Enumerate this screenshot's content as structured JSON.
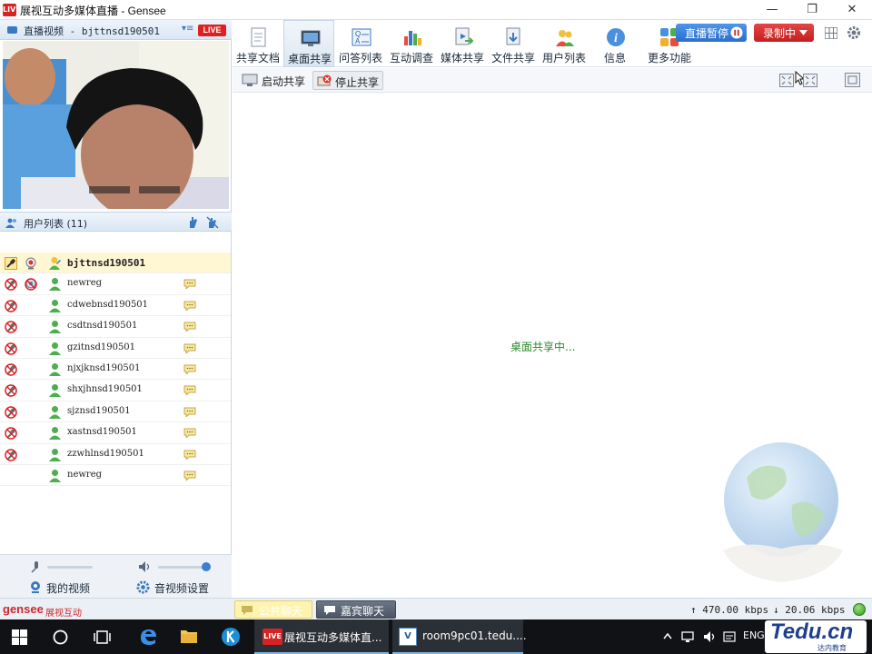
{
  "window": {
    "title": "展视互动多媒体直播 - Gensee",
    "logo_text": "LIVE",
    "min_label": "—",
    "restore_label": "❐",
    "close_label": "✕"
  },
  "video_panel": {
    "title": "直播视频 - bjttnsd190501",
    "dropdown_icon": "▾≡",
    "live_badge": "LIVE"
  },
  "user_list": {
    "title": "用户列表 (11)",
    "users": [
      {
        "name": "bjttnsd190501",
        "selected": true,
        "mic": "mic-active",
        "cam": "cam-active",
        "avatar": "presenter",
        "chat": false
      },
      {
        "name": "newreg",
        "selected": false,
        "mic": "mic-muted",
        "cam": "cam-off",
        "avatar": "user",
        "chat": true
      },
      {
        "name": "cdwebnsd190501",
        "selected": false,
        "mic": "mic-muted",
        "cam": "",
        "avatar": "user",
        "chat": true
      },
      {
        "name": "csdtnsd190501",
        "selected": false,
        "mic": "mic-muted",
        "cam": "",
        "avatar": "user",
        "chat": true
      },
      {
        "name": "gzitnsd190501",
        "selected": false,
        "mic": "mic-muted",
        "cam": "",
        "avatar": "user",
        "chat": true
      },
      {
        "name": "njxjknsd190501",
        "selected": false,
        "mic": "mic-muted",
        "cam": "",
        "avatar": "user",
        "chat": true
      },
      {
        "name": "shxjhnsd190501",
        "selected": false,
        "mic": "mic-muted",
        "cam": "",
        "avatar": "user",
        "chat": true
      },
      {
        "name": "sjznsd190501",
        "selected": false,
        "mic": "mic-muted",
        "cam": "",
        "avatar": "user",
        "chat": true
      },
      {
        "name": "xastnsd190501",
        "selected": false,
        "mic": "mic-muted",
        "cam": "",
        "avatar": "user",
        "chat": true
      },
      {
        "name": "zzwhlnsd190501",
        "selected": false,
        "mic": "mic-muted",
        "cam": "",
        "avatar": "user",
        "chat": true
      },
      {
        "name": "newreg",
        "selected": false,
        "mic": "",
        "cam": "",
        "avatar": "user",
        "chat": true
      }
    ]
  },
  "left_footer": {
    "mic_level": 0.0,
    "volume_level": 1.0,
    "my_video_label": "我的视频",
    "av_settings_label": "音视频设置"
  },
  "toolbar": {
    "items": [
      {
        "label": "共享文档",
        "icon": "document-icon",
        "active": false
      },
      {
        "label": "桌面共享",
        "icon": "desktop-share-icon",
        "active": true
      },
      {
        "label": "问答列表",
        "icon": "qa-list-icon",
        "active": false
      },
      {
        "label": "互动调查",
        "icon": "survey-chart-icon",
        "active": false
      },
      {
        "label": "媒体共享",
        "icon": "media-share-icon",
        "active": false
      },
      {
        "label": "文件共享",
        "icon": "file-share-icon",
        "active": false
      },
      {
        "label": "用户列表",
        "icon": "users-icon",
        "active": false
      },
      {
        "label": "信息",
        "icon": "info-icon",
        "active": false
      },
      {
        "label": "更多功能",
        "icon": "more-apps-icon",
        "active": false
      }
    ],
    "pause_label": "直播暂停",
    "record_label": "录制中"
  },
  "subtoolbar": {
    "start_share_label": "启动共享",
    "stop_share_label": "停止共享"
  },
  "share_area": {
    "status_text": "桌面共享中..."
  },
  "statusbar": {
    "logo_text": "gensee",
    "logo_sub": "展视互动",
    "public_chat_label": "公共聊天",
    "guest_chat_label": "嘉宾聊天",
    "upload_speed": "↑ 470.00 kbps",
    "download_speed": "↓ 20.06 kbps"
  },
  "taskbar": {
    "app1_label": "展视互动多媒体直...",
    "app2_label": "room9pc01.tedu....",
    "lang": "ENG",
    "tedu_text": "Tedu.cn",
    "tedu_sub": "达内教育"
  },
  "colors": {
    "accent_blue": "#2a6fcc",
    "record_red": "#c41f1f",
    "status_green": "#2b8a2b",
    "live_red": "#e02020"
  }
}
